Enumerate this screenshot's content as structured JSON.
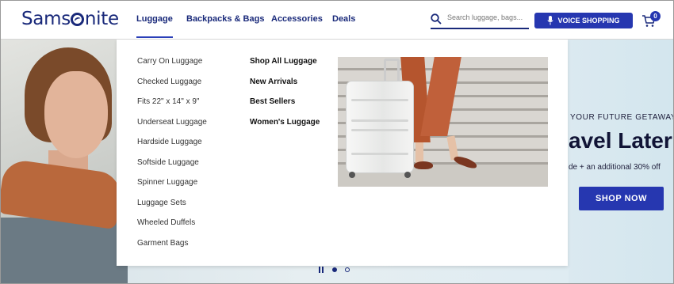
{
  "brand": {
    "logo_before": "Sams",
    "logo_after": "nite"
  },
  "nav": {
    "items": [
      {
        "label": "Luggage",
        "active": true
      },
      {
        "label": "Backpacks & Bags",
        "active": false
      },
      {
        "label": "Accessories",
        "active": false
      },
      {
        "label": "Deals",
        "active": false
      }
    ]
  },
  "search": {
    "placeholder": "Search luggage, bags...",
    "value": ""
  },
  "voice": {
    "label": "VOICE SHOPPING"
  },
  "cart": {
    "count": "0"
  },
  "menu": {
    "categories": [
      "Carry On Luggage",
      "Checked Luggage",
      "Fits 22\" x 14\" x 9\"",
      "Underseat Luggage",
      "Hardside Luggage",
      "Softside Luggage",
      "Spinner Luggage",
      "Luggage Sets",
      "Wheeled Duffels",
      "Garment Bags"
    ],
    "featured": [
      "Shop All Luggage",
      "New Arrivals",
      "Best Sellers",
      "Women's Luggage"
    ]
  },
  "hero": {
    "kicker": "YOUR FUTURE GETAWAY",
    "headline": "avel Later",
    "subtext": "de + an additional 30% off",
    "cta": "SHOP NOW"
  },
  "colors": {
    "brand_blue": "#19297a",
    "accent_blue": "#2637b0"
  }
}
